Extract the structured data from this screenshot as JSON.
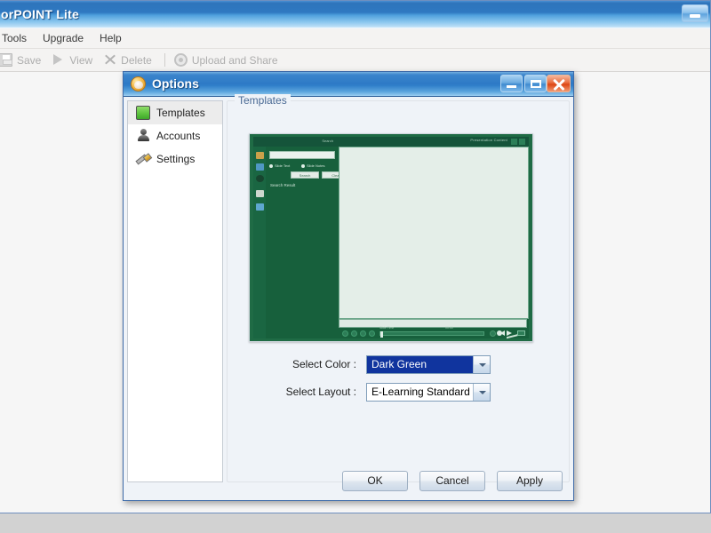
{
  "app": {
    "title": "orPOINT Lite",
    "minimize_icon": "minimize-icon",
    "menu": [
      {
        "label": "Tools"
      },
      {
        "label": "Upgrade"
      },
      {
        "label": "Help"
      }
    ],
    "toolbar": [
      {
        "label": "Save",
        "icon": "save-icon",
        "enabled": false
      },
      {
        "label": "View",
        "icon": "play-icon",
        "enabled": false
      },
      {
        "label": "Delete",
        "icon": "close-x-icon",
        "enabled": false
      },
      {
        "label": "Upload and Share",
        "icon": "upload-icon",
        "enabled": false
      }
    ]
  },
  "dialog": {
    "title": "Options",
    "icon": "options-app-icon",
    "window_buttons": {
      "minimize": "minimize-icon",
      "maximize": "maximize-icon",
      "close": "close-icon"
    },
    "sidebar": {
      "items": [
        {
          "label": "Templates",
          "icon": "templates-icon",
          "selected": true
        },
        {
          "label": "Accounts",
          "icon": "accounts-person-icon",
          "selected": false
        },
        {
          "label": "Settings",
          "icon": "settings-screwdriver-icon",
          "selected": false
        }
      ]
    },
    "group": {
      "legend": "Templates"
    },
    "preview": {
      "header_title": "Presentation Content",
      "search_label": "Search",
      "input_value": "",
      "radio_one": "Slide Text",
      "radio_two": "Slide Notes",
      "button_search": "Search",
      "button_clear": "Clear",
      "result_label": "Search Result",
      "seek_label": "Slide Time",
      "seek_time": "00:00"
    },
    "fields": [
      {
        "label": "Select Color :",
        "value": "Dark Green",
        "highlighted": true,
        "arrow_icon": "chevron-down-icon"
      },
      {
        "label": "Select Layout :",
        "value": "E-Learning Standard",
        "highlighted": false,
        "arrow_icon": "chevron-down-icon"
      }
    ],
    "actions": [
      {
        "label": "OK"
      },
      {
        "label": "Cancel"
      },
      {
        "label": "Apply"
      }
    ]
  },
  "colors": {
    "title_blue": "#2e7ac6",
    "selection_blue": "#10349e",
    "template_green": "#17603c",
    "close_red": "#dd4715"
  }
}
